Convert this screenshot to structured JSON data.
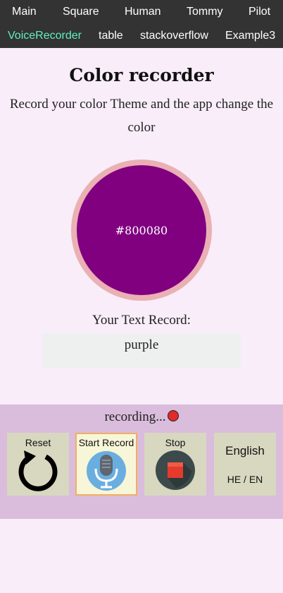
{
  "nav": {
    "row1": [
      "Main",
      "Square",
      "Human",
      "Tommy",
      "Pilot"
    ],
    "row2": [
      "VoiceRecorder",
      "table",
      "stackoverflow",
      "Example3"
    ],
    "active": "VoiceRecorder"
  },
  "page": {
    "title": "Color recorder",
    "description": "Record your color Theme and the app change the color"
  },
  "color": {
    "hex": "#800080",
    "ring": "#eab0b4"
  },
  "record": {
    "label": "Your Text Record:",
    "value": "purple"
  },
  "controls": {
    "status": "recording...",
    "reset_label": "Reset",
    "start_label": "Start Record",
    "stop_label": "Stop",
    "language_label": "English",
    "language_toggle": "HE / EN"
  },
  "icons": {
    "reset": "refresh-icon",
    "start": "microphone-icon",
    "stop": "stop-icon",
    "recording": "recording-dot-icon"
  }
}
